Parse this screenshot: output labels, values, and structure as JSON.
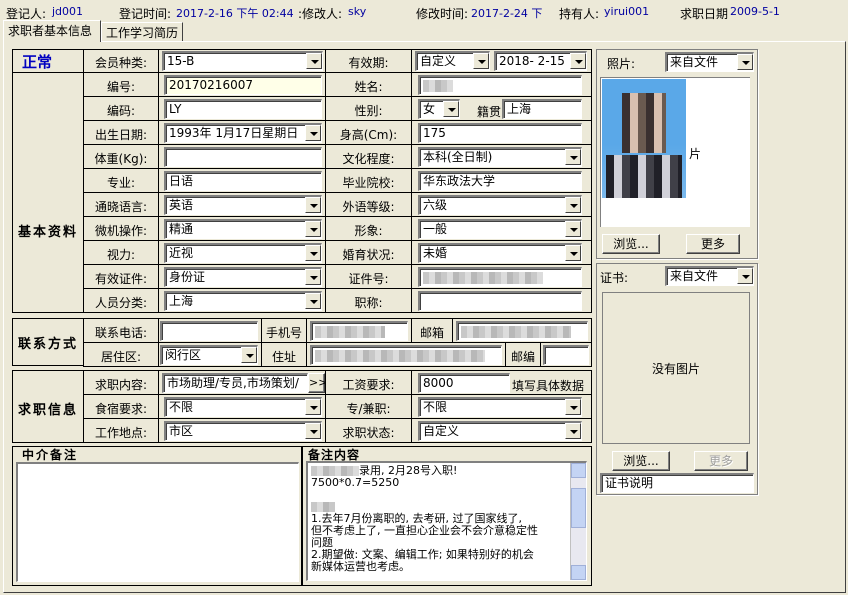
{
  "top_bar": {
    "registrar_label": "登记人:",
    "registrar_value": "jd001",
    "reg_time_label": "登记时间:",
    "reg_time_value": "2017-2-16 下午 02:44",
    "modifier_label": ":修改人:",
    "modifier_value": "sky",
    "mod_time_label": "修改时间:",
    "mod_time_value": "2017-2-24 下",
    "holder_label": "持有人:",
    "holder_value": "yirui001",
    "job_date_label": "求职日期",
    "job_date_value": "2009-5-1"
  },
  "tabs": [
    {
      "label": "求职者基本信息",
      "active": true
    },
    {
      "label": "工作学习简历",
      "active": false
    }
  ],
  "status": {
    "label": "正常"
  },
  "member_type": {
    "label": "会员种类:",
    "value": "15-B"
  },
  "validity": {
    "label": "有效期:",
    "mode": "自定义",
    "date": "2018- 2-15"
  },
  "photo": {
    "label": "照片:",
    "source": "来自文件",
    "side_char": "片",
    "browse": "浏览...",
    "more": "更多"
  },
  "basic": {
    "section_title": "基本资料",
    "id_label": "编号:",
    "id_value": "20170216007",
    "name_label": "姓名:",
    "code_label": "编码:",
    "code_value": "LY",
    "gender_label": "性别:",
    "gender_value": "女",
    "native_label": "籍贯",
    "native_value": "上海",
    "birth_label": "出生日期:",
    "birth_value": "1993年 1月17日星期日",
    "height_label": "身高(Cm):",
    "height_value": "175",
    "weight_label": "体重(Kg):",
    "weight_value": "",
    "edu_label": "文化程度:",
    "edu_value": "本科(全日制)",
    "major_label": "专业:",
    "major_value": "日语",
    "school_label": "毕业院校:",
    "school_value": "华东政法大学",
    "lang_label": "通晓语言:",
    "lang_value": "英语",
    "lang_level_label": "外语等级:",
    "lang_level_value": "六级",
    "computer_label": "微机操作:",
    "computer_value": "精通",
    "image_label": "形象:",
    "image_value": "一般",
    "vision_label": "视力:",
    "vision_value": "近视",
    "marital_label": "婚育状况:",
    "marital_value": "未婚",
    "cert_type_label": "有效证件:",
    "cert_type_value": "身份证",
    "cert_no_label": "证件号:",
    "category_label": "人员分类:",
    "category_value": "上海",
    "title_label": "职称:",
    "title_value": ""
  },
  "contact": {
    "section_title": "联系方式",
    "phone_label": "联系电话:",
    "phone_value": "",
    "mobile_label": "手机号",
    "email_label": "邮箱",
    "district_label": "居住区:",
    "district_value": "闵行区",
    "address_label": "住址",
    "zip_label": "邮编",
    "zip_value": ""
  },
  "job": {
    "section_title": "求职信息",
    "content_label": "求职内容:",
    "content_value": "市场助理/专员,市场策划/",
    "more_btn": ">>",
    "salary_label": "工资要求:",
    "salary_value": "8000",
    "salary_hint": "填写具体数据",
    "board_label": "食宿要求:",
    "board_value": "不限",
    "fulltime_label": "专/兼职:",
    "fulltime_value": "不限",
    "location_label": "工作地点:",
    "location_value": "市区",
    "status_label": "求职状态:",
    "status_value": "自定义"
  },
  "certificate": {
    "label": "证书:",
    "source": "来自文件",
    "no_image": "没有图片",
    "browse": "浏览...",
    "more": "更多",
    "desc": "证书说明"
  },
  "agency_note": {
    "title": "中介备注",
    "value": ""
  },
  "remarks": {
    "title": "备注内容",
    "lines": [
      "录用, 2月28号入职!",
      "7500*0.7=5250",
      "",
      "",
      "  1.去年7月份离职的, 去考研, 过了国家线了,",
      "但不考虑上了, 一直担心企业会不会介意稳定性",
      "问题",
      "  2.期望做: 文案、编辑工作; 如果特别好的机会",
      "新媒体运营也考虑。"
    ]
  }
}
